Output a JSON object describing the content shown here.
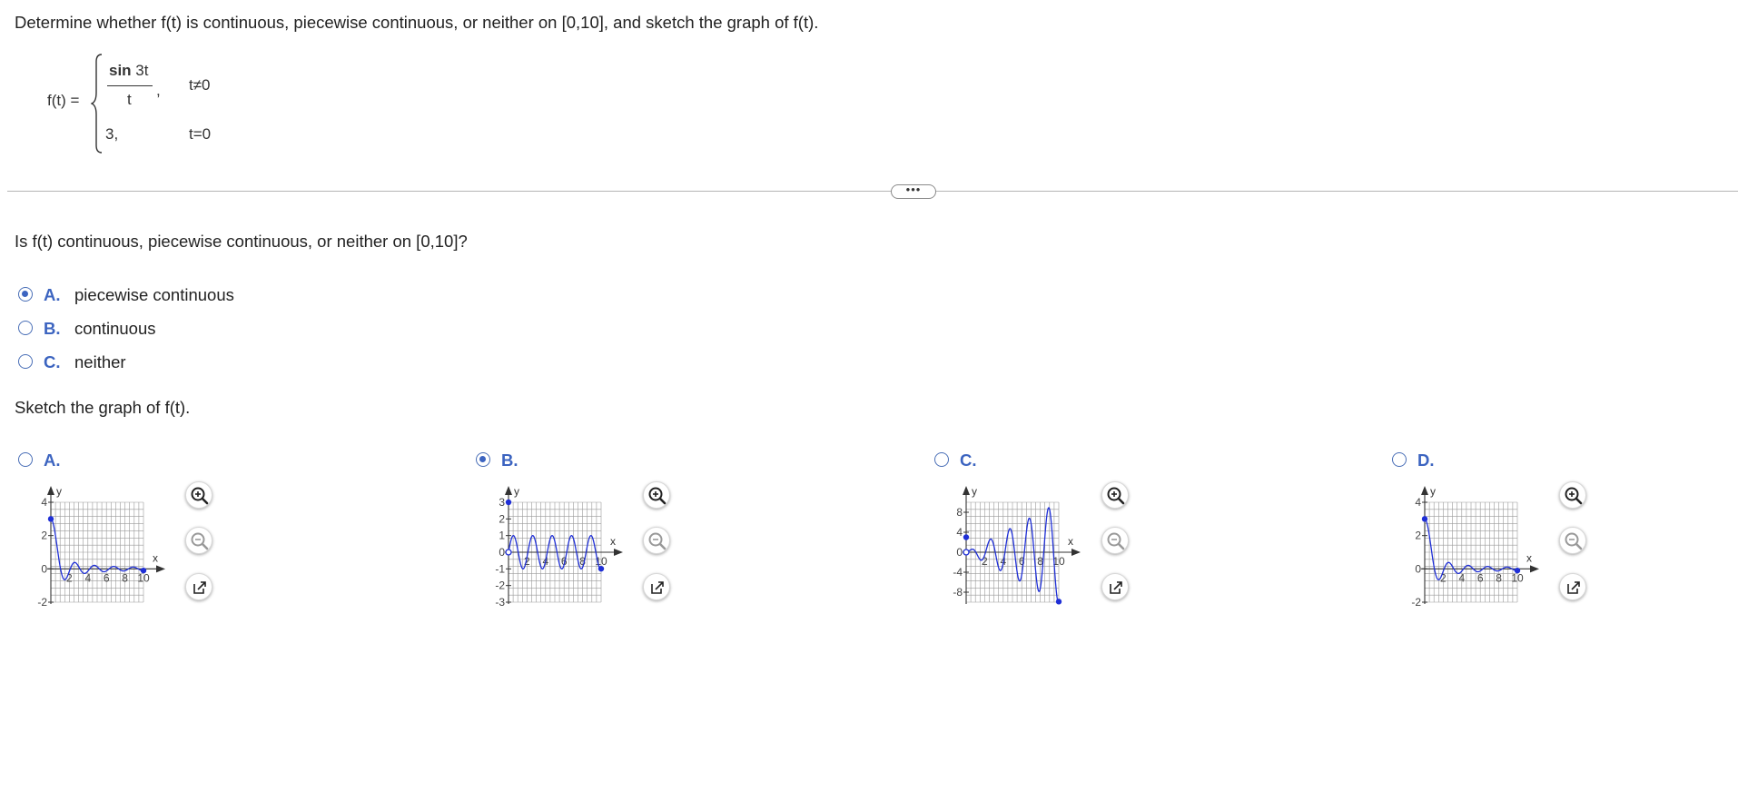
{
  "question": {
    "prompt": "Determine whether f(t) is continuous, piecewise continuous, or neither on [0,10], and sketch the graph of f(t).",
    "function": {
      "lhs": "f(t) =",
      "case1_num_bold": "sin",
      "case1_num_rest": " 3t",
      "case1_den": "t",
      "case1_comma": ",",
      "case1_cond": "t≠0",
      "case2_val": "3,",
      "case2_cond": "t=0"
    }
  },
  "more_button": "•••",
  "part1": {
    "question": "Is f(t) continuous, piecewise continuous, or neither on [0,10]?",
    "options": [
      {
        "letter": "A.",
        "text": "piecewise continuous",
        "selected": true
      },
      {
        "letter": "B.",
        "text": "continuous",
        "selected": false
      },
      {
        "letter": "C.",
        "text": "neither",
        "selected": false
      }
    ]
  },
  "part2": {
    "question": "Sketch the graph of f(t).",
    "options": [
      {
        "letter": "A.",
        "selected": false
      },
      {
        "letter": "B.",
        "selected": true
      },
      {
        "letter": "C.",
        "selected": false
      },
      {
        "letter": "D.",
        "selected": false
      }
    ]
  },
  "colors": {
    "accent": "#3c64c0",
    "curve": "#1f2fd6",
    "grid": "#9a9a9a"
  },
  "chart_data": [
    {
      "type": "line",
      "title": "A",
      "xlabel": "x",
      "ylabel": "y",
      "xlim": [
        0,
        10
      ],
      "ylim": [
        -2,
        4
      ],
      "xticks": [
        "2",
        "4",
        "6",
        "8",
        "10"
      ],
      "yticks": [
        "4",
        "2",
        "0",
        "-2"
      ],
      "series": [
        {
          "function": "sin(3t)/t",
          "closed_points": [
            [
              0,
              3
            ],
            [
              10,
              -0.099
            ]
          ]
        }
      ],
      "grid": true
    },
    {
      "type": "line",
      "title": "B",
      "xlabel": "x",
      "ylabel": "y",
      "xlim": [
        0,
        10
      ],
      "ylim": [
        -3,
        3
      ],
      "xticks": [
        "2",
        "4",
        "6",
        "8",
        "10"
      ],
      "yticks": [
        "3",
        "2",
        "1",
        "0",
        "-1",
        "-2",
        "-3"
      ],
      "series": [
        {
          "function": "sin(3t)",
          "closed_points": [
            [
              0,
              3
            ],
            [
              10,
              -0.99
            ]
          ],
          "open_points": [
            [
              0,
              0
            ]
          ]
        }
      ],
      "grid": true
    },
    {
      "type": "line",
      "title": "C",
      "xlabel": "x",
      "ylabel": "y",
      "xlim": [
        0,
        10
      ],
      "ylim": [
        -10,
        10
      ],
      "xticks": [
        "2",
        "4",
        "6",
        "8",
        "10"
      ],
      "yticks": [
        "8",
        "4",
        "0",
        "-4",
        "-8"
      ],
      "series": [
        {
          "function": "t·sin(3t)",
          "closed_points": [
            [
              0,
              3
            ],
            [
              10,
              -9.88
            ]
          ],
          "open_points": [
            [
              0,
              0
            ]
          ]
        }
      ],
      "grid": true
    },
    {
      "type": "line",
      "title": "D",
      "xlabel": "x",
      "ylabel": "y",
      "xlim": [
        0,
        10
      ],
      "ylim": [
        -2,
        4
      ],
      "xticks": [
        "2",
        "4",
        "6",
        "8",
        "10"
      ],
      "yticks": [
        "4",
        "2",
        "0",
        "-2"
      ],
      "series": [
        {
          "function": "sin(3t)/t",
          "closed_points": [
            [
              0,
              3
            ],
            [
              10,
              -0.099
            ]
          ]
        }
      ],
      "grid": true
    }
  ]
}
